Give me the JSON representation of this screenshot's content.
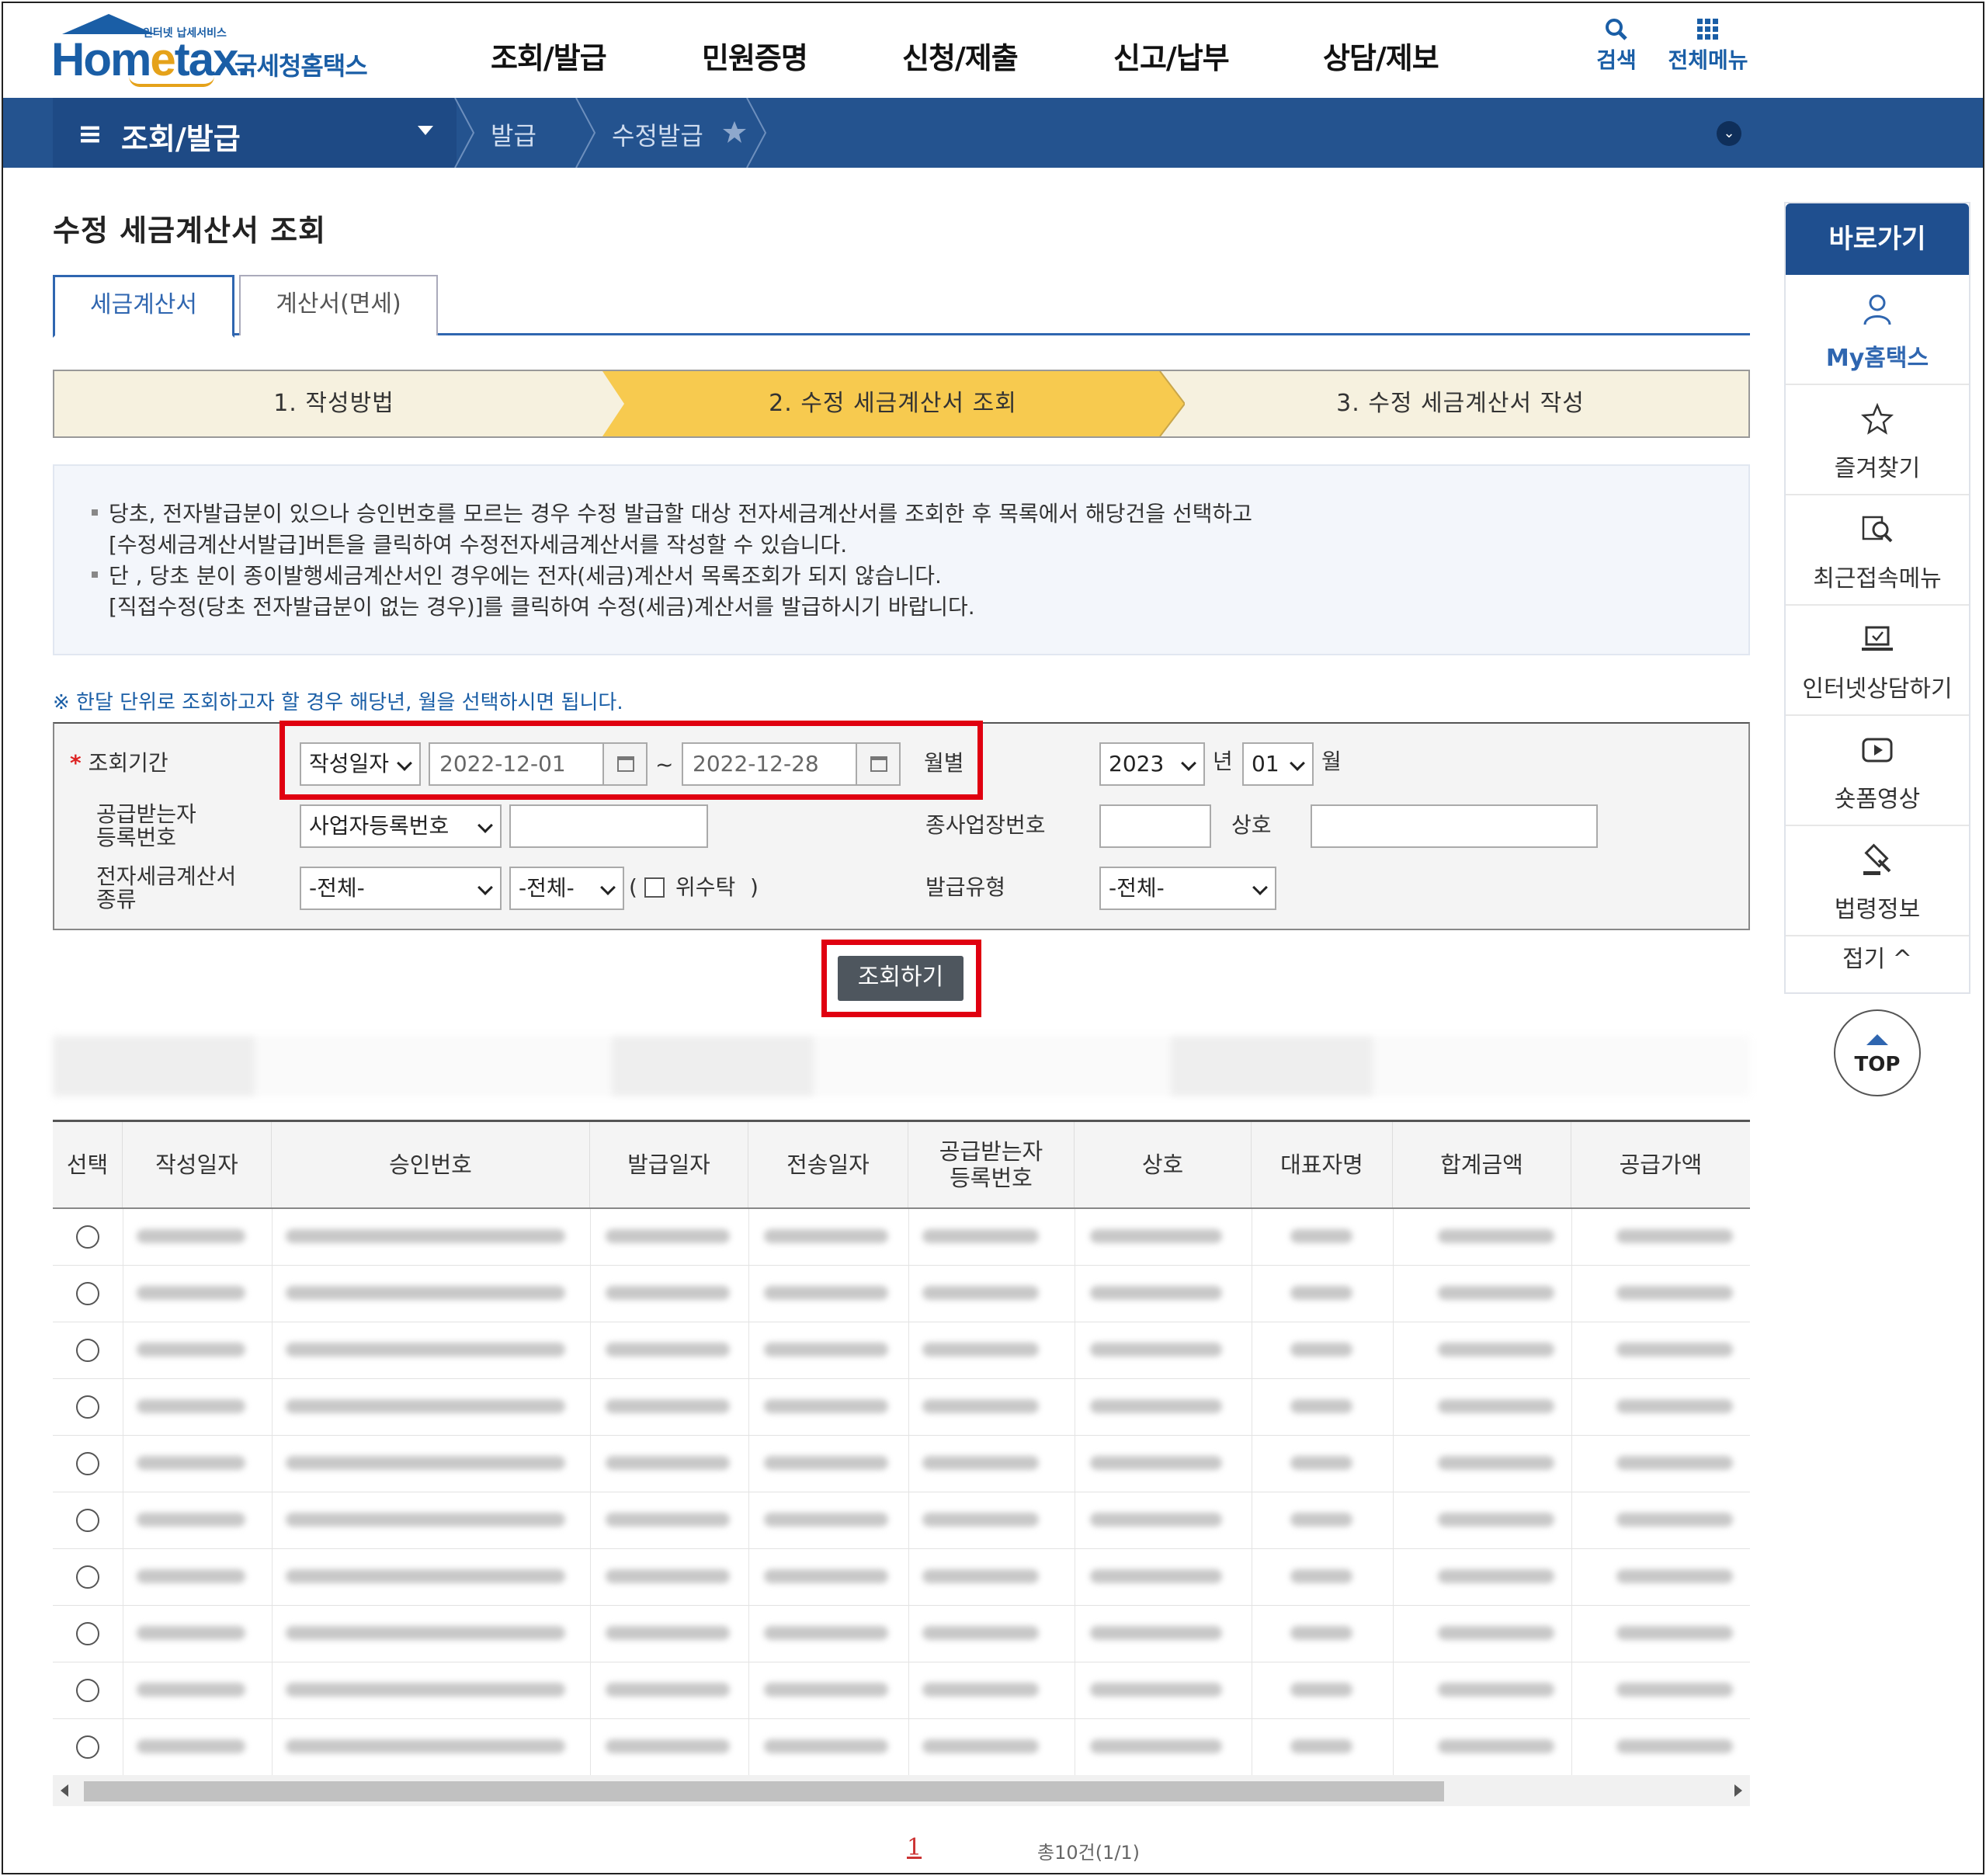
{
  "header": {
    "logo_small": "인터넷 납세서비스",
    "logo_brand_a": "Hom",
    "logo_brand_e": "e",
    "logo_brand_b": "tax.",
    "logo_kr": "국세청홈택스",
    "nav": [
      "조회/발급",
      "민원증명",
      "신청/제출",
      "신고/납부",
      "상담/제보"
    ],
    "search_label": "검색",
    "menu_label": "전체메뉴"
  },
  "subbar": {
    "section": "조회/발급",
    "crumbs": [
      "발급",
      "수정발급"
    ]
  },
  "page": {
    "title": "수정 세금계산서 조회",
    "tabs": [
      "세금계산서",
      "계산서(면세)"
    ],
    "steps": [
      "1. 작성방법",
      "2. 수정 세금계산서 조회",
      "3. 수정 세금계산서 작성"
    ],
    "info": [
      "당초, 전자발급분이 있으나 승인번호를 모르는 경우 수정 발급할 대상 전자세금계산서를 조회한 후 목록에서 해당건을 선택하고",
      "[수정세금계산서발급]버튼을 클릭하여 수정전자세금계산서를 작성할 수 있습니다.",
      "단 , 당초 분이 종이발행세금계산서인 경우에는 전자(세금)계산서 목록조회가 되지 않습니다.",
      "[직접수정(당초 전자발급분이 없는 경우)]를 클릭하여 수정(세금)계산서를 발급하시기 바랍니다."
    ],
    "note": "※ 한달 단위로 조회하고자 할 경우 해당년, 월을 선택하시면 됩니다."
  },
  "form": {
    "period_label": "조회기간",
    "required_mark": "*",
    "date_type": "작성일자",
    "date_from": "2022-12-01",
    "tilde": "~",
    "date_to": "2022-12-28",
    "monthly": "월별",
    "year": "2023",
    "year_unit": "년",
    "month": "01",
    "month_unit": "월",
    "buyer_label_1": "공급받는자",
    "buyer_label_2": "등록번호",
    "buyer_type": "사업자등록번호",
    "sub_biz_label": "종사업장번호",
    "company_label": "상호",
    "kind_label_1": "전자세금계산서",
    "kind_label_2": "종류",
    "kind_1": "-전체-",
    "kind_2": "-전체-",
    "consign_open": "(",
    "consign_label": "위수탁",
    "consign_close": ")",
    "issue_type_label": "발급유형",
    "issue_type": "-전체-",
    "query_button": "조회하기"
  },
  "table": {
    "headers": [
      "선택",
      "작성일자",
      "승인번호",
      "발급일자",
      "전송일자",
      "공급받는자 등록번호",
      "상호",
      "대표자명",
      "합계금액",
      "공급가액"
    ],
    "row_count": 10
  },
  "pagination": {
    "current": "1",
    "total": "총10건(1/1)"
  },
  "quick": {
    "title": "바로가기",
    "items": [
      "My홈택스",
      "즐겨찾기",
      "최근접속메뉴",
      "인터넷상담하기",
      "숏폼영상",
      "법령정보"
    ],
    "fold": "접기",
    "top": "TOP"
  },
  "colors": {
    "brand_blue": "#1a5ea6",
    "bar_blue": "#24538f",
    "step_active": "#f7ca4f",
    "highlight_red": "#e00010"
  }
}
